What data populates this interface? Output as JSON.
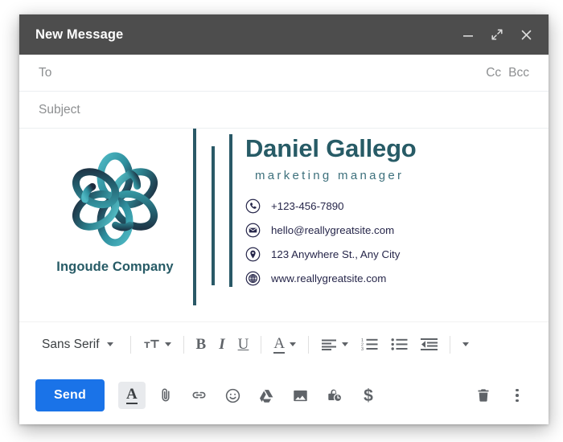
{
  "window": {
    "title": "New Message",
    "controls": [
      {
        "name": "minimize-icon",
        "label": "Minimize"
      },
      {
        "name": "expand-icon",
        "label": "Expand"
      },
      {
        "name": "close-icon",
        "label": "Close"
      }
    ]
  },
  "fields": {
    "to_placeholder": "To",
    "cc_label": "Cc",
    "bcc_label": "Bcc",
    "subject_placeholder": "Subject"
  },
  "signature": {
    "company_name": "Ingoude Company",
    "logo_icon": "interlocked-knot-logo",
    "person_name": "Daniel Gallego",
    "person_role": "marketing manager",
    "contacts": [
      {
        "icon": "phone-icon",
        "text": "+123-456-7890"
      },
      {
        "icon": "envelope-icon",
        "text": "hello@reallygreatsite.com"
      },
      {
        "icon": "location-pin-icon",
        "text": "123 Anywhere St., Any City"
      },
      {
        "icon": "globe-icon",
        "text": "www.reallygreatsite.com"
      }
    ],
    "colors": {
      "teal": "#2a5967",
      "name_teal": "#275b66",
      "role_teal": "#3d707c",
      "contact_navy": "#26264a"
    }
  },
  "format_toolbar": {
    "font_name": "Sans Serif",
    "font_size_icon": "font-size-icon",
    "bold_label": "B",
    "italic_label": "I",
    "underline_label": "U",
    "text_color_label": "A",
    "align_icon": "align-left-icon",
    "numbered_list_icon": "numbered-list-icon",
    "bulleted_list_icon": "bulleted-list-icon",
    "indent_icon": "indent-less-icon",
    "more_icon": "chevron-down-icon"
  },
  "action_bar": {
    "send_label": "Send",
    "left_icons": [
      {
        "name": "formatting-options-icon",
        "glyph": "A",
        "active": true
      },
      {
        "name": "attach-file-icon",
        "glyph": "paperclip",
        "active": false
      },
      {
        "name": "insert-link-icon",
        "glyph": "link",
        "active": false
      },
      {
        "name": "insert-emoji-icon",
        "glyph": "emoji",
        "active": false
      },
      {
        "name": "insert-drive-icon",
        "glyph": "drive",
        "active": false
      },
      {
        "name": "insert-photo-icon",
        "glyph": "photo",
        "active": false
      },
      {
        "name": "confidential-mode-icon",
        "glyph": "lock-clock",
        "active": false
      },
      {
        "name": "insert-money-icon",
        "glyph": "$",
        "active": false
      }
    ],
    "right_icons": [
      {
        "name": "discard-draft-icon",
        "glyph": "trash"
      },
      {
        "name": "more-options-icon",
        "glyph": "kebab"
      }
    ]
  },
  "theme": {
    "titlebar_bg": "#4d4d4d",
    "send_blue": "#1a73e8",
    "icon_gray": "#5f6368",
    "placeholder_gray": "#8d8f91"
  }
}
